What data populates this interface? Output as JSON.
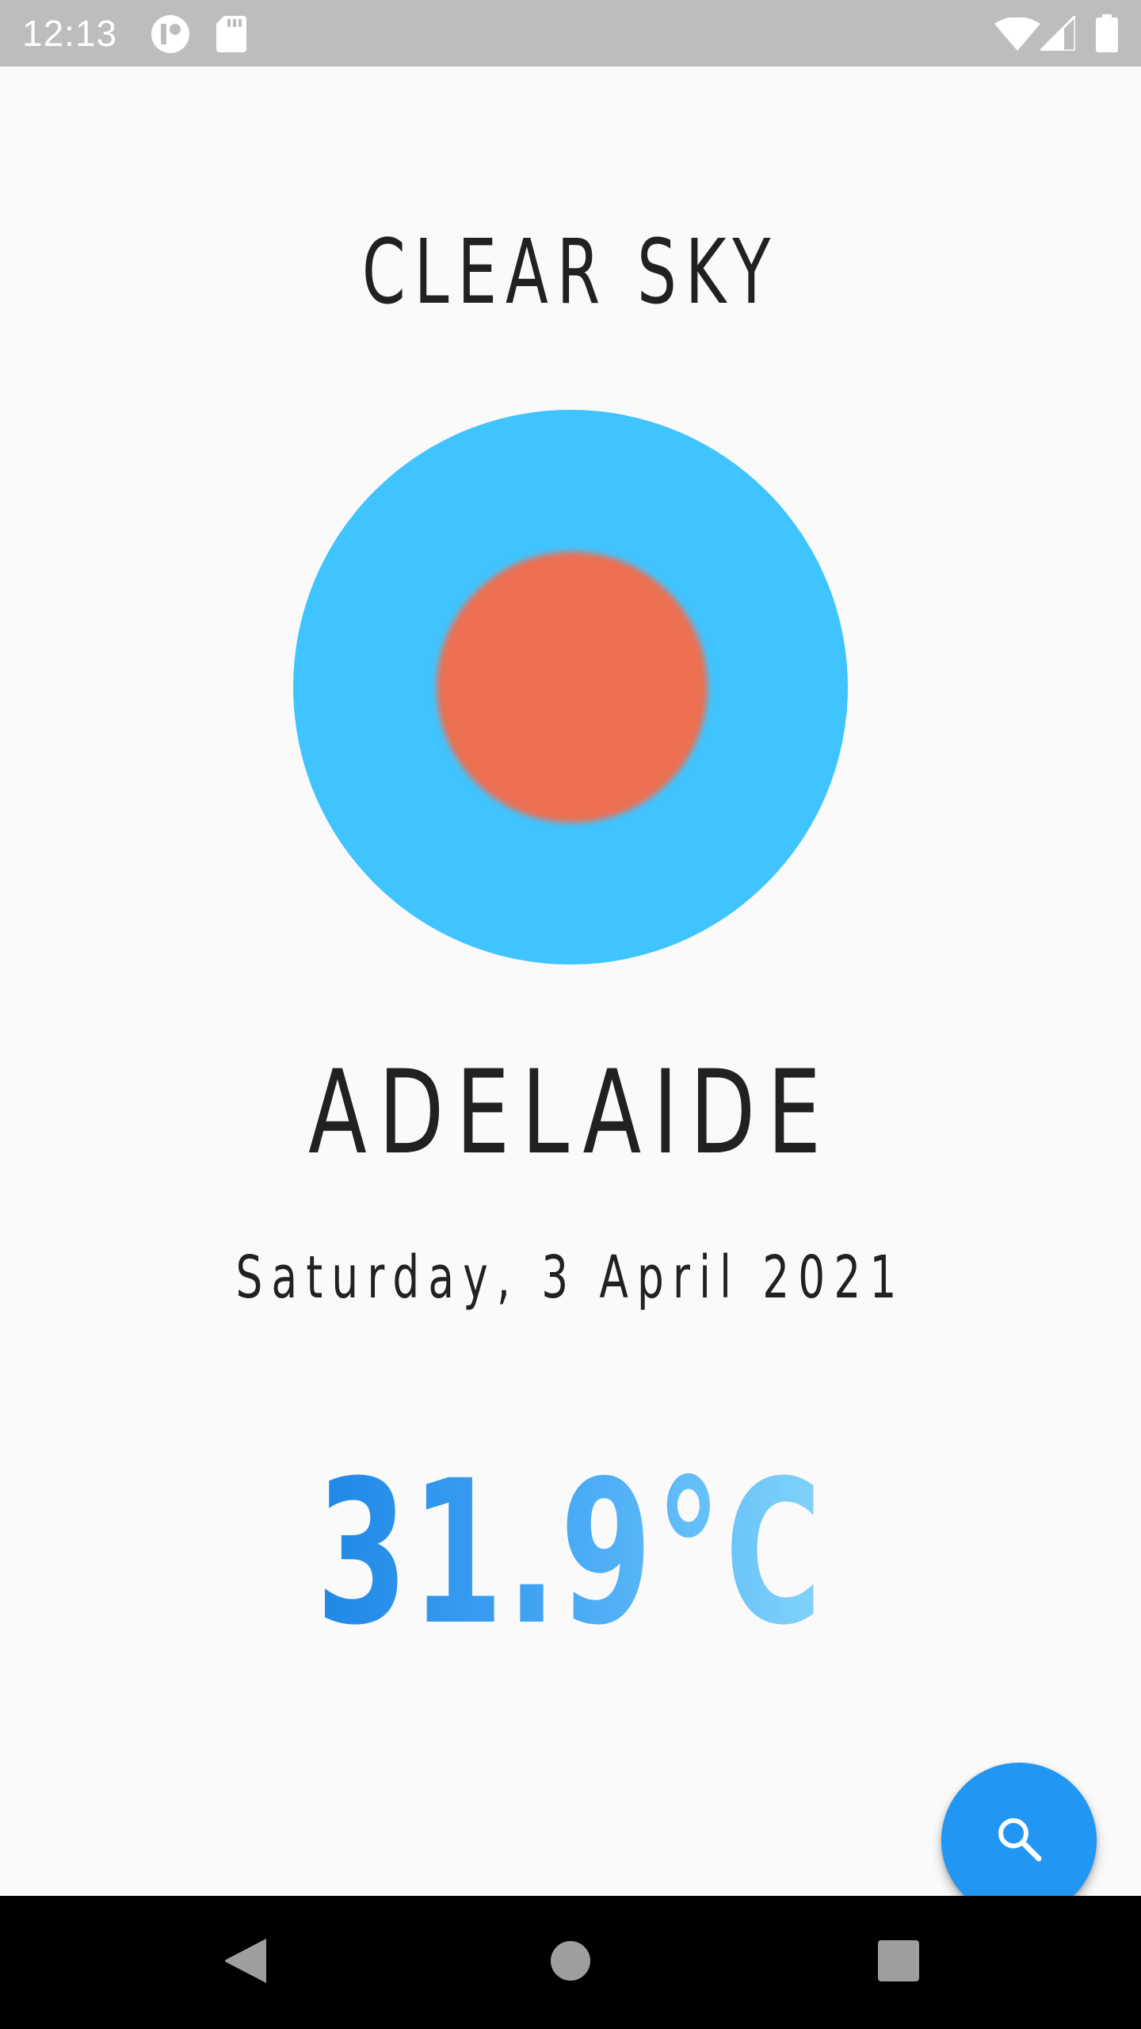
{
  "status_bar": {
    "time": "12:13",
    "icons": [
      "app-notification-icon",
      "sd-card-icon",
      "wifi-icon",
      "cell-signal-icon",
      "battery-icon"
    ]
  },
  "weather": {
    "condition": "CLEAR SKY",
    "city": "ADELAIDE",
    "date": "Saturday, 3 April 2021",
    "temperature": "31.9°C"
  },
  "colors": {
    "sky": "#40C4FF",
    "sun": "#EC7051",
    "accent": "#2196F3",
    "text": "#212121"
  },
  "fab": {
    "icon": "search-icon"
  },
  "nav_bar": {
    "buttons": [
      "back-icon",
      "home-icon",
      "recents-icon"
    ]
  }
}
